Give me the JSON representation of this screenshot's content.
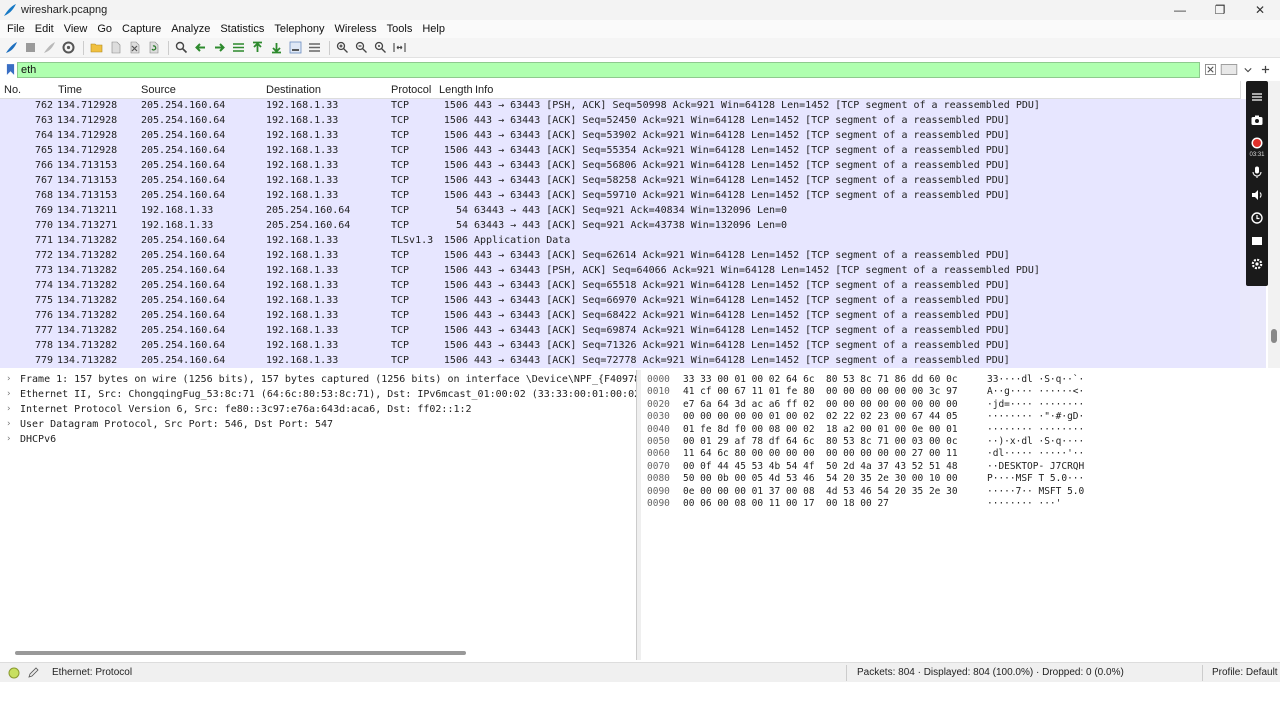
{
  "window": {
    "title": "wireshark.pcapng"
  },
  "menu": [
    "File",
    "Edit",
    "View",
    "Go",
    "Capture",
    "Analyze",
    "Statistics",
    "Telephony",
    "Wireless",
    "Tools",
    "Help"
  ],
  "filter": {
    "value": "eth"
  },
  "columns": {
    "no": "No.",
    "time": "Time",
    "source": "Source",
    "destination": "Destination",
    "protocol": "Protocol",
    "length": "Length",
    "info": "Info"
  },
  "packets": [
    {
      "no": "762",
      "time": "134.712928",
      "src": "205.254.160.64",
      "dst": "192.168.1.33",
      "proto": "TCP",
      "len": "1506",
      "info": "443 → 63443 [PSH, ACK] Seq=50998 Ack=921 Win=64128 Len=1452 [TCP segment of a reassembled PDU]"
    },
    {
      "no": "763",
      "time": "134.712928",
      "src": "205.254.160.64",
      "dst": "192.168.1.33",
      "proto": "TCP",
      "len": "1506",
      "info": "443 → 63443 [ACK] Seq=52450 Ack=921 Win=64128 Len=1452 [TCP segment of a reassembled PDU]"
    },
    {
      "no": "764",
      "time": "134.712928",
      "src": "205.254.160.64",
      "dst": "192.168.1.33",
      "proto": "TCP",
      "len": "1506",
      "info": "443 → 63443 [ACK] Seq=53902 Ack=921 Win=64128 Len=1452 [TCP segment of a reassembled PDU]"
    },
    {
      "no": "765",
      "time": "134.712928",
      "src": "205.254.160.64",
      "dst": "192.168.1.33",
      "proto": "TCP",
      "len": "1506",
      "info": "443 → 63443 [ACK] Seq=55354 Ack=921 Win=64128 Len=1452 [TCP segment of a reassembled PDU]"
    },
    {
      "no": "766",
      "time": "134.713153",
      "src": "205.254.160.64",
      "dst": "192.168.1.33",
      "proto": "TCP",
      "len": "1506",
      "info": "443 → 63443 [ACK] Seq=56806 Ack=921 Win=64128 Len=1452 [TCP segment of a reassembled PDU]"
    },
    {
      "no": "767",
      "time": "134.713153",
      "src": "205.254.160.64",
      "dst": "192.168.1.33",
      "proto": "TCP",
      "len": "1506",
      "info": "443 → 63443 [ACK] Seq=58258 Ack=921 Win=64128 Len=1452 [TCP segment of a reassembled PDU]"
    },
    {
      "no": "768",
      "time": "134.713153",
      "src": "205.254.160.64",
      "dst": "192.168.1.33",
      "proto": "TCP",
      "len": "1506",
      "info": "443 → 63443 [ACK] Seq=59710 Ack=921 Win=64128 Len=1452 [TCP segment of a reassembled PDU]"
    },
    {
      "no": "769",
      "time": "134.713211",
      "src": "192.168.1.33",
      "dst": "205.254.160.64",
      "proto": "TCP",
      "len": "54",
      "info": "63443 → 443 [ACK] Seq=921 Ack=40834 Win=132096 Len=0"
    },
    {
      "no": "770",
      "time": "134.713271",
      "src": "192.168.1.33",
      "dst": "205.254.160.64",
      "proto": "TCP",
      "len": "54",
      "info": "63443 → 443 [ACK] Seq=921 Ack=43738 Win=132096 Len=0"
    },
    {
      "no": "771",
      "time": "134.713282",
      "src": "205.254.160.64",
      "dst": "192.168.1.33",
      "proto": "TLSv1.3",
      "len": "1506",
      "info": "Application Data"
    },
    {
      "no": "772",
      "time": "134.713282",
      "src": "205.254.160.64",
      "dst": "192.168.1.33",
      "proto": "TCP",
      "len": "1506",
      "info": "443 → 63443 [ACK] Seq=62614 Ack=921 Win=64128 Len=1452 [TCP segment of a reassembled PDU]"
    },
    {
      "no": "773",
      "time": "134.713282",
      "src": "205.254.160.64",
      "dst": "192.168.1.33",
      "proto": "TCP",
      "len": "1506",
      "info": "443 → 63443 [PSH, ACK] Seq=64066 Ack=921 Win=64128 Len=1452 [TCP segment of a reassembled PDU]"
    },
    {
      "no": "774",
      "time": "134.713282",
      "src": "205.254.160.64",
      "dst": "192.168.1.33",
      "proto": "TCP",
      "len": "1506",
      "info": "443 → 63443 [ACK] Seq=65518 Ack=921 Win=64128 Len=1452 [TCP segment of a reassembled PDU]"
    },
    {
      "no": "775",
      "time": "134.713282",
      "src": "205.254.160.64",
      "dst": "192.168.1.33",
      "proto": "TCP",
      "len": "1506",
      "info": "443 → 63443 [ACK] Seq=66970 Ack=921 Win=64128 Len=1452 [TCP segment of a reassembled PDU]"
    },
    {
      "no": "776",
      "time": "134.713282",
      "src": "205.254.160.64",
      "dst": "192.168.1.33",
      "proto": "TCP",
      "len": "1506",
      "info": "443 → 63443 [ACK] Seq=68422 Ack=921 Win=64128 Len=1452 [TCP segment of a reassembled PDU]"
    },
    {
      "no": "777",
      "time": "134.713282",
      "src": "205.254.160.64",
      "dst": "192.168.1.33",
      "proto": "TCP",
      "len": "1506",
      "info": "443 → 63443 [ACK] Seq=69874 Ack=921 Win=64128 Len=1452 [TCP segment of a reassembled PDU]"
    },
    {
      "no": "778",
      "time": "134.713282",
      "src": "205.254.160.64",
      "dst": "192.168.1.33",
      "proto": "TCP",
      "len": "1506",
      "info": "443 → 63443 [ACK] Seq=71326 Ack=921 Win=64128 Len=1452 [TCP segment of a reassembled PDU]"
    },
    {
      "no": "779",
      "time": "134.713282",
      "src": "205.254.160.64",
      "dst": "192.168.1.33",
      "proto": "TCP",
      "len": "1506",
      "info": "443 → 63443 [ACK] Seq=72778 Ack=921 Win=64128 Len=1452 [TCP segment of a reassembled PDU]"
    }
  ],
  "details": [
    "Frame 1: 157 bytes on wire (1256 bits), 157 bytes captured (1256 bits) on interface \\Device\\NPF_{F40978E",
    "Ethernet II, Src: ChongqingFug_53:8c:71 (64:6c:80:53:8c:71), Dst: IPv6mcast_01:00:02 (33:33:00:01:00:02)",
    "Internet Protocol Version 6, Src: fe80::3c97:e76a:643d:aca6, Dst: ff02::1:2",
    "User Datagram Protocol, Src Port: 546, Dst Port: 547",
    "DHCPv6"
  ],
  "bytes": [
    {
      "off": "0000",
      "hex": "33 33 00 01 00 02 64 6c  80 53 8c 71 86 dd 60 0c",
      "ascii": "33····dl ·S·q··`·"
    },
    {
      "off": "0010",
      "hex": "41 cf 00 67 11 01 fe 80  00 00 00 00 00 00 3c 97",
      "ascii": "A··g···· ······<·"
    },
    {
      "off": "0020",
      "hex": "e7 6a 64 3d ac a6 ff 02  00 00 00 00 00 00 00 00",
      "ascii": "·jd=···· ········"
    },
    {
      "off": "0030",
      "hex": "00 00 00 00 00 01 00 02  02 22 02 23 00 67 44 05",
      "ascii": "········ ·\"·#·gD·"
    },
    {
      "off": "0040",
      "hex": "01 fe 8d f0 00 08 00 02  18 a2 00 01 00 0e 00 01",
      "ascii": "········ ········"
    },
    {
      "off": "0050",
      "hex": "00 01 29 af 78 df 64 6c  80 53 8c 71 00 03 00 0c",
      "ascii": "··)·x·dl ·S·q····"
    },
    {
      "off": "0060",
      "hex": "11 64 6c 80 00 00 00 00  00 00 00 00 00 27 00 11",
      "ascii": "·dl····· ·····'··"
    },
    {
      "off": "0070",
      "hex": "00 0f 44 45 53 4b 54 4f  50 2d 4a 37 43 52 51 48",
      "ascii": "··DESKTOP- J7CRQH"
    },
    {
      "off": "0080",
      "hex": "50 00 0b 00 05 4d 53 46  54 20 35 2e 30 00 10 00",
      "ascii": "P····MSF T 5.0···"
    },
    {
      "off": "0090",
      "hex": "0e 00 00 00 01 37 00 08  4d 53 46 54 20 35 2e 30",
      "ascii": "·····7·· MSFT 5.0"
    },
    {
      "off": "0090",
      "hex": "00 06 00 08 00 11 00 17  00 18 00 27",
      "ascii": "········ ···'"
    }
  ],
  "status": {
    "profile_text": "Ethernet: Protocol",
    "packets": "Packets: 804 · Displayed: 804 (100.0%) · Dropped: 0 (0.0%)",
    "profile": "Profile: Default"
  },
  "recorder": {
    "timer": "03:31"
  },
  "colors": {
    "row_bg": "#e7e6ff",
    "filter_ok": "#afffaf"
  }
}
